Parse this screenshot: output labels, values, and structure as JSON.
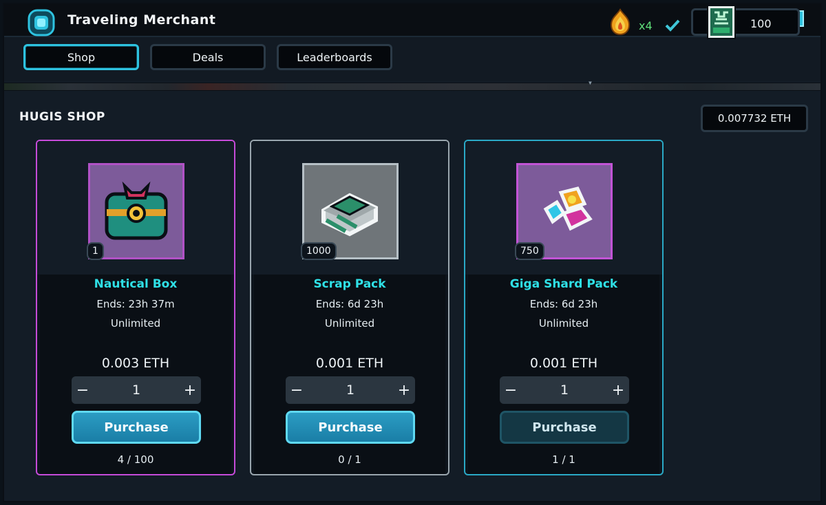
{
  "window": {
    "title": "Traveling Merchant",
    "close_icon": "close-icon"
  },
  "nav": {
    "tabs": [
      {
        "label": "Shop",
        "active": true
      },
      {
        "label": "Deals",
        "active": false
      },
      {
        "label": "Leaderboards",
        "active": false
      }
    ],
    "multiplier": "x4",
    "energy_value": "100",
    "icons": {
      "flame": "flame-icon",
      "check": "check-icon",
      "energy": "energy-card-icon"
    }
  },
  "shop": {
    "heading": "HUGIS SHOP",
    "wallet_balance": "0.007732 ETH",
    "items": [
      {
        "name": "Nautical Box",
        "ends": "Ends: 23h 37m",
        "limit": "Unlimited",
        "price": "0.003 ETH",
        "quantity": "1",
        "badge": "1",
        "purchase_label": "Purchase",
        "sold": "4 / 100",
        "icon": "nautical-box-icon",
        "accent": "#c64bd9"
      },
      {
        "name": "Scrap Pack",
        "ends": "Ends: 6d 23h",
        "limit": "Unlimited",
        "price": "0.001 ETH",
        "quantity": "1",
        "badge": "1000",
        "purchase_label": "Purchase",
        "sold": "0 / 1",
        "icon": "scrap-pack-icon",
        "accent": "#9aa6ae"
      },
      {
        "name": "Giga Shard Pack",
        "ends": "Ends: 6d 23h",
        "limit": "Unlimited",
        "price": "0.001 ETH",
        "quantity": "1",
        "badge": "750",
        "purchase_label": "Purchase",
        "sold": "1 / 1",
        "icon": "giga-shard-pack-icon",
        "accent": "#2aa9c6"
      }
    ],
    "stepper": {
      "minus": "−",
      "plus": "+"
    }
  },
  "colors": {
    "accent_cyan": "#2ec3e0",
    "name_text": "#2fe0e6",
    "multiplier_green": "#5fe07a",
    "purchase_button": "#1f8fb8"
  }
}
